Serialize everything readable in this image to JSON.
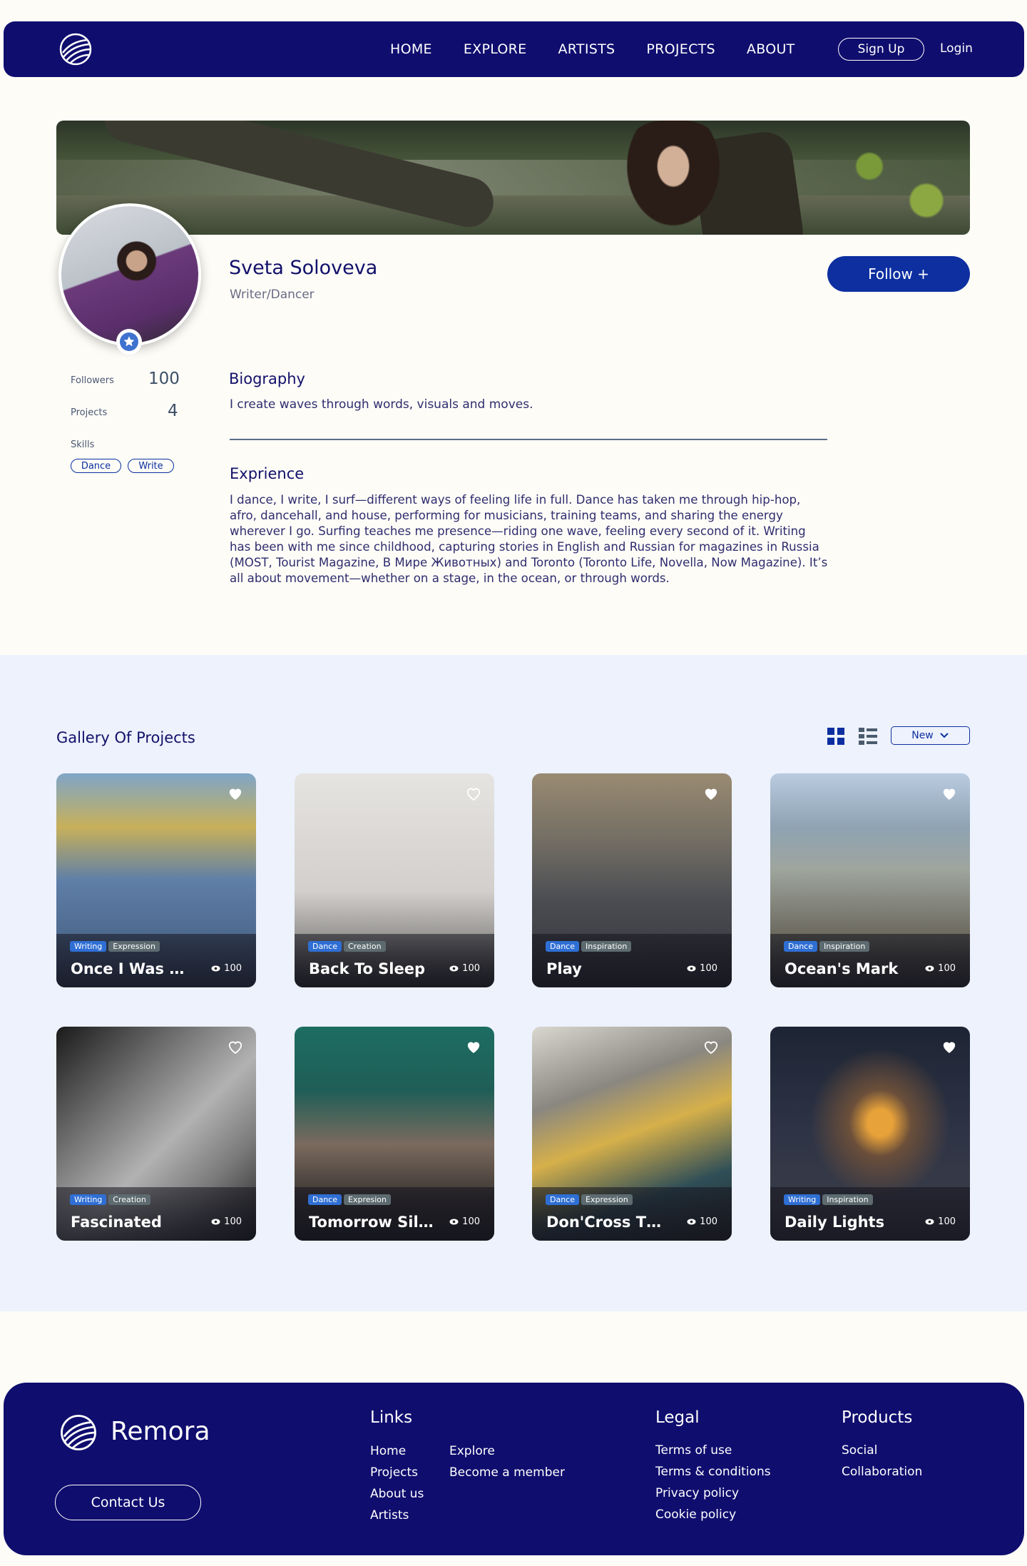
{
  "nav": {
    "items": [
      "HOME",
      "EXPLORE",
      "ARTISTS",
      "PROJECTS",
      "ABOUT"
    ],
    "signup": "Sign Up",
    "login": "Login"
  },
  "profile": {
    "name": "Sveta Soloveva",
    "role": "Writer/Dancer",
    "follow_label": "Follow +",
    "followers_label": "Followers",
    "followers_value": "100",
    "projects_label": "Projects",
    "projects_value": "4",
    "skills_label": "Skills",
    "skills": [
      "Dance",
      "Write"
    ],
    "biography_heading": "Biography",
    "biography_text": "I create waves through words, visuals and moves.",
    "experience_heading": "Exprience",
    "experience_text": "I dance, I write, I surf—different ways of feeling life in full. Dance has taken me through hip-hop, afro, dancehall, and house, performing for musicians, training teams, and sharing the energy wherever I go. Surfing teaches me presence—riding one wave, feeling every second of it. Writing has been with me since childhood, capturing stories in English and Russian for magazines in Russia (MOST, Tourist Magazine, В Мире Животных) and Toronto (Toronto Life, Novella, Now Magazine). It’s all about movement—whether on a stage, in the ocean, or through words."
  },
  "gallery": {
    "title": "Gallery Of Projects",
    "sort_label": "New",
    "cards": [
      {
        "title": "Once I Was B...",
        "tags": [
          "Writing",
          "Expression"
        ],
        "views": "100"
      },
      {
        "title": "Back To Sleep",
        "tags": [
          "Dance",
          "Creation"
        ],
        "views": "100"
      },
      {
        "title": "Play",
        "tags": [
          "Dance",
          "Inspiration"
        ],
        "views": "100"
      },
      {
        "title": "Ocean's Mark",
        "tags": [
          "Dance",
          "Inspiration"
        ],
        "views": "100"
      },
      {
        "title": "Fascinated",
        "tags": [
          "Writing",
          "Creation"
        ],
        "views": "100"
      },
      {
        "title": "Tomorrow Silver",
        "tags": [
          "Dance",
          "Expresion"
        ],
        "views": "100"
      },
      {
        "title": "Don'Cross Th...",
        "tags": [
          "Dance",
          "Expression"
        ],
        "views": "100"
      },
      {
        "title": "Daily Lights",
        "tags": [
          "Writing",
          "Inspiration"
        ],
        "views": "100"
      }
    ]
  },
  "footer": {
    "brand": "Remora",
    "contact_label": "Contact Us",
    "links_heading": "Links",
    "links_col1": [
      "Home",
      "Projects",
      "About us",
      "Artists"
    ],
    "links_col2": [
      "Explore",
      "Become a member"
    ],
    "legal_heading": "Legal",
    "legal": [
      "Terms of use",
      "Terms & conditions",
      "Privacy policy",
      "Cookie policy"
    ],
    "products_heading": "Products",
    "products": [
      "Social",
      "Collaboration"
    ]
  },
  "colors": {
    "navy": "#0F0D6E",
    "accent": "#0D2FA0",
    "gallery_bg": "#EDF2FD",
    "page_bg": "#FDFCF7"
  }
}
